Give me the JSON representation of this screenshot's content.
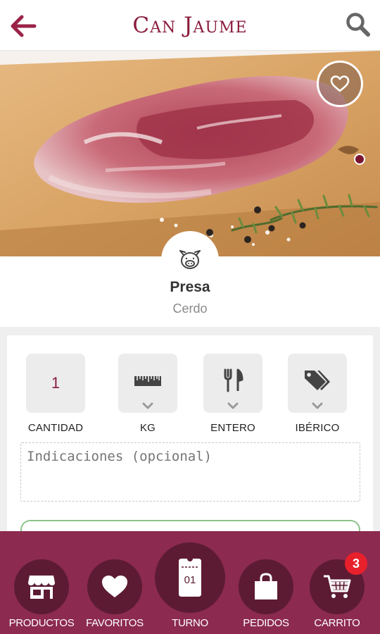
{
  "header": {
    "brand": "Can Jaume"
  },
  "product": {
    "name": "Presa",
    "category": "Cerdo"
  },
  "options": [
    {
      "value": "1",
      "label": "CANTIDAD"
    },
    {
      "label": "KG"
    },
    {
      "label": "ENTERO"
    },
    {
      "label": "IBÉRICO"
    }
  ],
  "notes": {
    "placeholder": "Indicaciones (opcional)"
  },
  "nav": {
    "items": [
      {
        "label": "PRODUCTOS"
      },
      {
        "label": "FAVORITOS"
      },
      {
        "label": "TURNO",
        "turn_number": "01"
      },
      {
        "label": "PEDIDOS"
      },
      {
        "label": "CARRITO"
      }
    ],
    "cart_count": "3"
  },
  "colors": {
    "brand": "#8a1c3c",
    "nav_background": "#8c2a4f",
    "nav_circle": "#5c1b33",
    "badge": "#e8202b"
  },
  "icons": [
    "back-arrow-icon",
    "search-icon",
    "heart-icon",
    "pig-icon",
    "ruler-icon",
    "cutlery-icon",
    "tags-icon",
    "chevron-down-icon",
    "store-icon",
    "ticket-icon",
    "shopping-bag-icon",
    "cart-icon"
  ]
}
